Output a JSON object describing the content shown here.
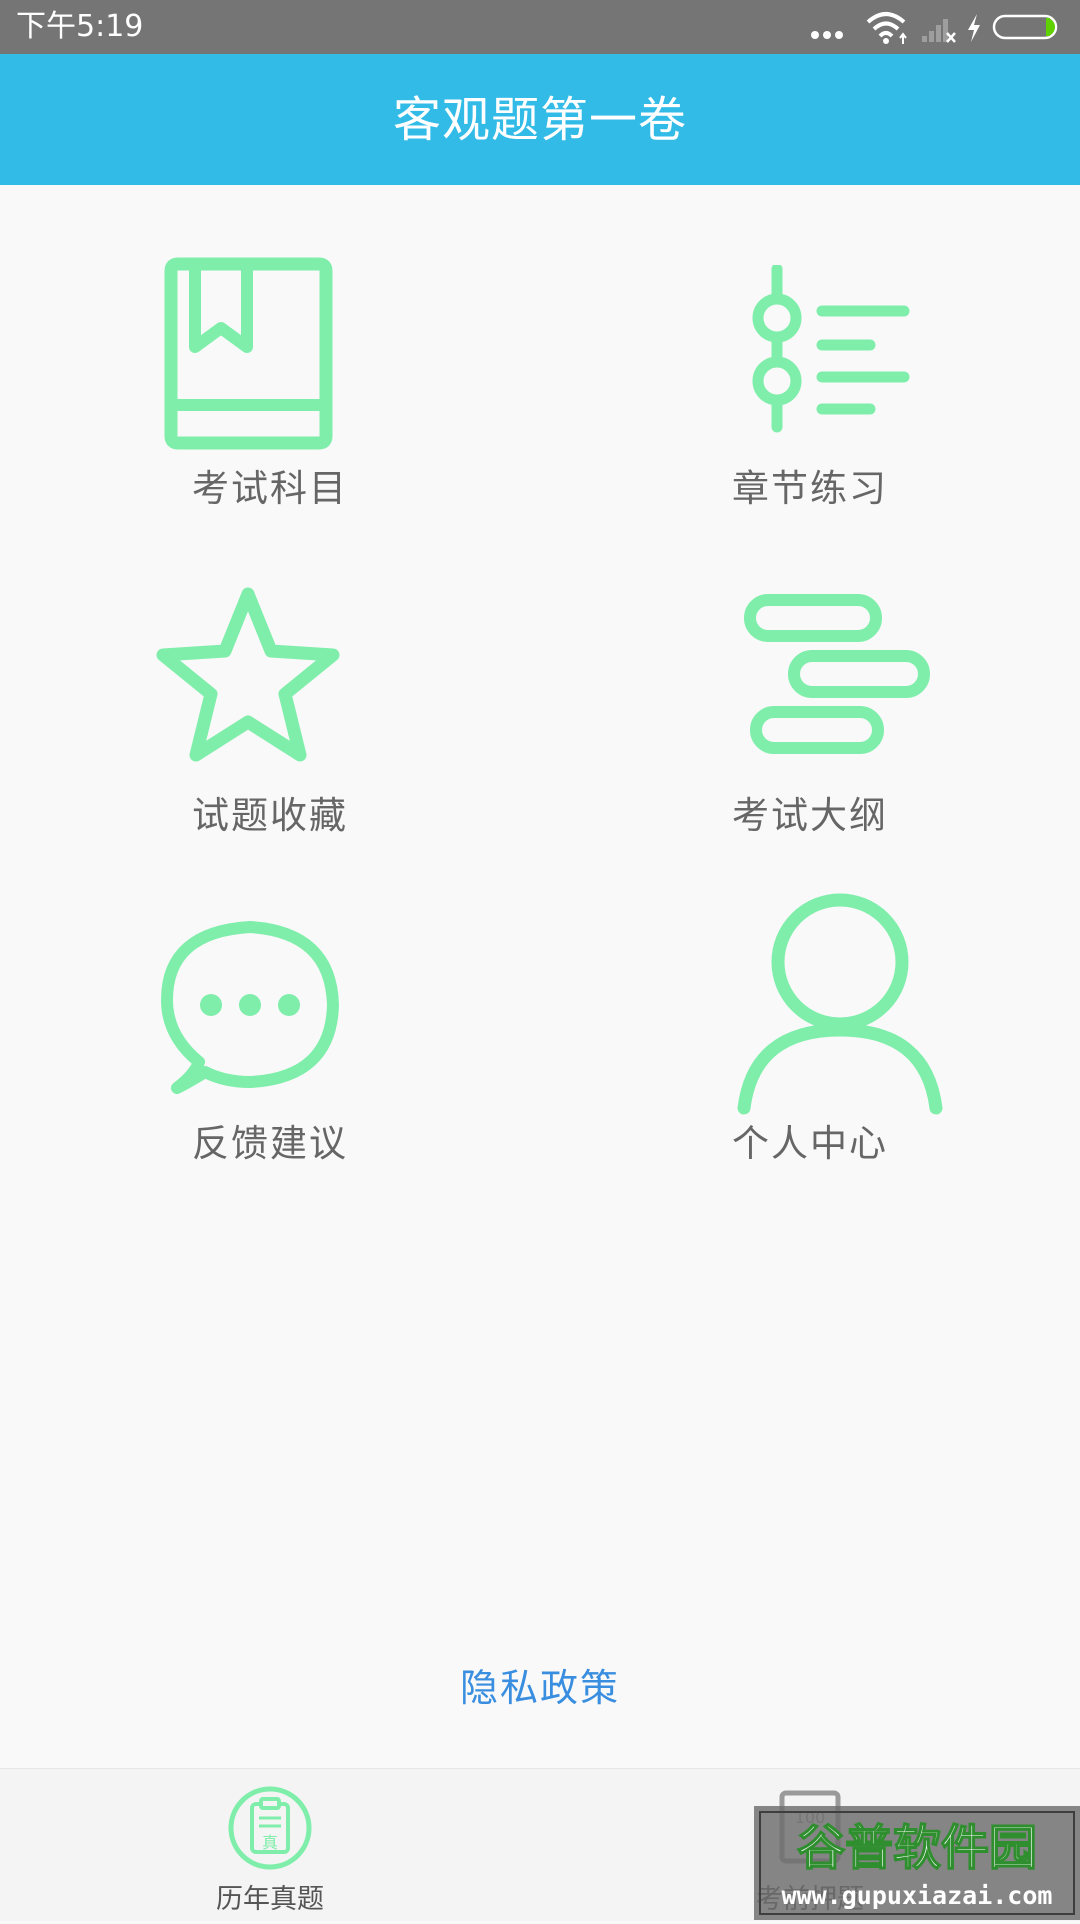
{
  "status_bar": {
    "time": "下午5:19",
    "icons": [
      "more-dots-icon",
      "wifi-icon",
      "signal-off-icon",
      "charging-bolt-icon",
      "battery-icon"
    ]
  },
  "header": {
    "title": "客观题第一卷"
  },
  "tiles": [
    {
      "label": "考试科目",
      "icon": "book-bookmark-icon"
    },
    {
      "label": "章节练习",
      "icon": "chapter-list-icon"
    },
    {
      "label": "试题收藏",
      "icon": "star-icon"
    },
    {
      "label": "考试大纲",
      "icon": "outline-bars-icon"
    },
    {
      "label": "反馈建议",
      "icon": "chat-bubble-icon"
    },
    {
      "label": "个人中心",
      "icon": "user-icon"
    }
  ],
  "privacy": {
    "label": "隐私政策"
  },
  "bottom_nav": [
    {
      "label": "历年真题",
      "icon": "past-papers-icon",
      "badge": "真"
    },
    {
      "label": "考前押题",
      "icon": "predicted-questions-icon",
      "badge": "100"
    }
  ],
  "watermark": {
    "cn": "谷普软件园",
    "url": "www.gupuxiazai.com"
  },
  "colors": {
    "accent": "#33bbe8",
    "icon_green": "#7feeaa",
    "link": "#3a8ee0",
    "label_gray": "#666666"
  }
}
